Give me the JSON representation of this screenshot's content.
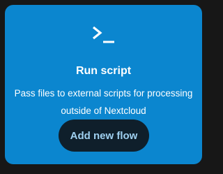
{
  "card": {
    "icon": "terminal-icon",
    "title": "Run script",
    "description": "Pass files to external scripts for processing outside of Nextcloud",
    "button_label": "Add new flow"
  },
  "colors": {
    "background": "#171717",
    "card": "#0b86cf",
    "button": "#0f1f2b",
    "button_text": "#9fd0f0"
  }
}
